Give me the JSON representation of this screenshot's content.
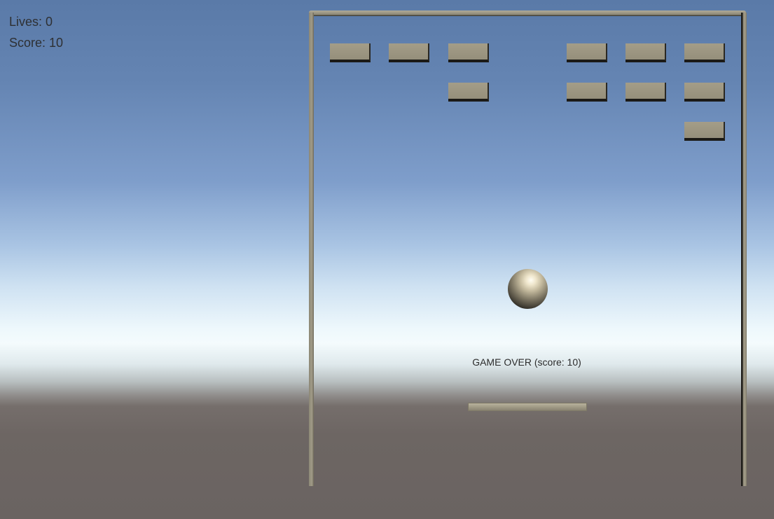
{
  "hud": {
    "lives_text": "Lives: 0",
    "score_text": "Score: 10"
  },
  "status": {
    "game_over_text": "GAME OVER (score: 10)"
  },
  "bricks": {
    "rows": [
      [
        true,
        true,
        true,
        false,
        true,
        true,
        true
      ],
      [
        false,
        false,
        true,
        false,
        true,
        true,
        true
      ],
      [
        false,
        false,
        false,
        false,
        false,
        false,
        true
      ]
    ]
  },
  "colors": {
    "brick": "#a49d88",
    "wall": "#a29c88",
    "paddle": "#b8b29c",
    "sky_top": "#5a7aa8",
    "ground": "#6a6361"
  }
}
